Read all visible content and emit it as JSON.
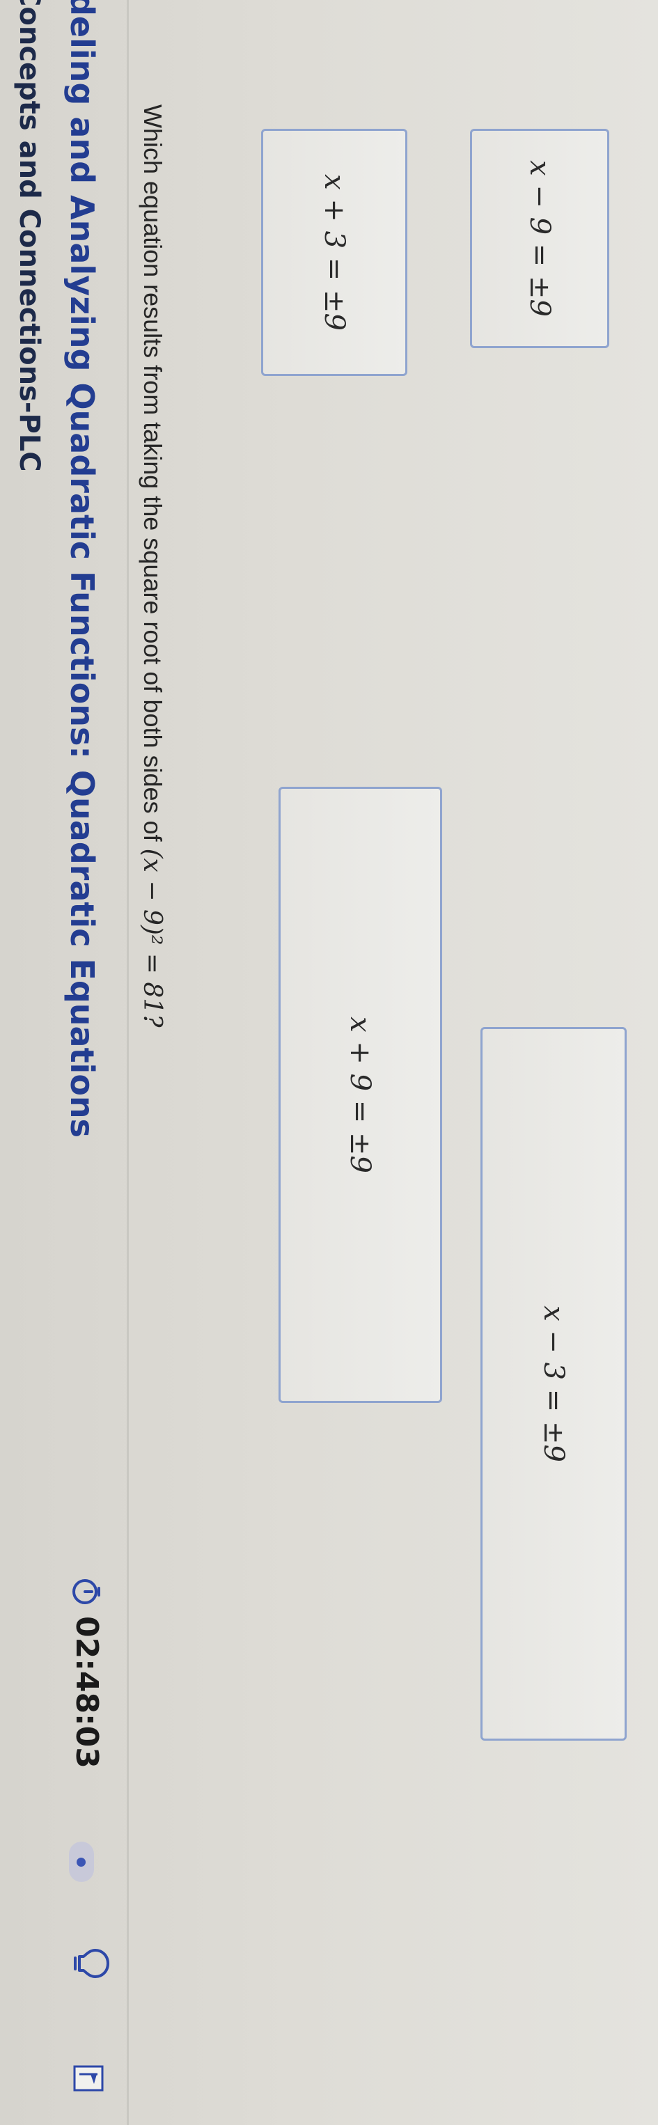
{
  "header": {
    "course": "Concepts and Connections-PLC",
    "lesson_title": "deling and Analyzing Quadratic Functions: Quadratic Equations"
  },
  "toolbar": {
    "timer": "02:48:03",
    "icons": {
      "timer": "stopwatch-icon",
      "status": "progress-dot-icon",
      "hint": "lightbulb-icon",
      "flag": "flag-icon"
    }
  },
  "question": {
    "prefix": "Which equation results from taking the square root of both sides of ",
    "math": "(x − 9)² = 81?"
  },
  "answers": [
    {
      "id": "a",
      "label": "x + 3 = ±9"
    },
    {
      "id": "b",
      "label": "x + 9 = ±9"
    },
    {
      "id": "c",
      "label": "x − 3 = ±9"
    },
    {
      "id": "d",
      "label": "x − 9 = ±9"
    }
  ],
  "colors": {
    "title": "#233d91",
    "answer_border": "#8fa4cf",
    "accent": "#3c56b5"
  }
}
